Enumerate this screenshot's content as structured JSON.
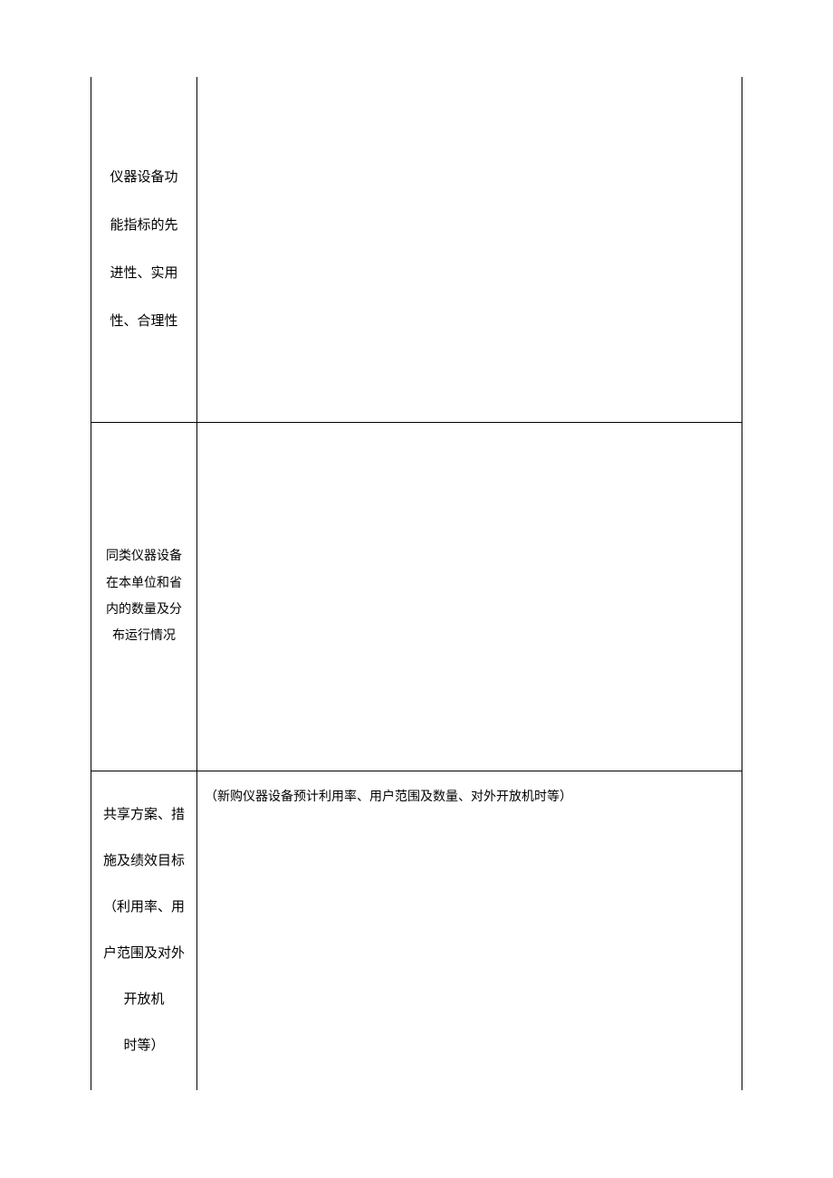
{
  "rows": [
    {
      "label_lines": [
        "仪器设备功",
        "能指标的先",
        "进性、实用",
        "性、合理性"
      ],
      "content": ""
    },
    {
      "label_lines": [
        "同类仪器设备",
        "在本单位和省",
        "内的数量及分",
        "布运行情况"
      ],
      "content": ""
    },
    {
      "label_lines": [
        "共享方案、措",
        "施及绩效目标",
        "（利用率、用",
        "户范围及对外",
        "开放机",
        "时等）"
      ],
      "content": "（新购仪器设备预计利用率、用户范围及数量、对外开放机时等）"
    }
  ]
}
